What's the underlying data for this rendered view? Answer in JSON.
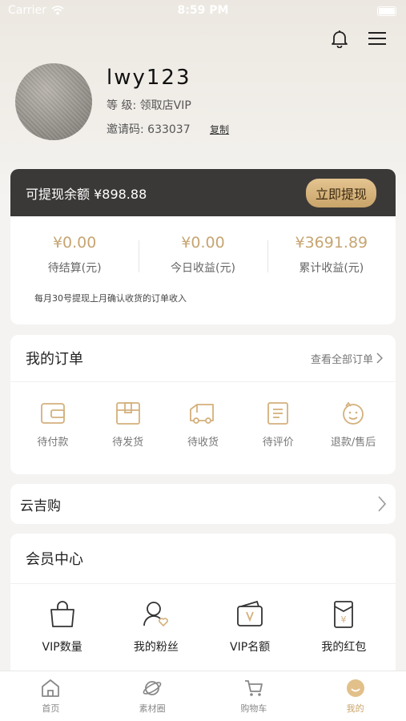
{
  "status_bar": {
    "carrier": "Carrier",
    "time": "8:59 PM"
  },
  "profile": {
    "username": "lwy123",
    "level": "等 级: 领取店VIP",
    "invite_code": "邀请码: 633037",
    "copy_label": "复制"
  },
  "wallet": {
    "withdrawable": "可提现余额 ¥898.88",
    "withdraw_button": "立即提现",
    "stats": [
      {
        "value": "¥0.00",
        "label": "待结算(元)"
      },
      {
        "value": "¥0.00",
        "label": "今日收益(元)"
      },
      {
        "value": "¥3691.89",
        "label": "累计收益(元)"
      }
    ],
    "note": "每月30号提现上月确认收货的订单收入"
  },
  "orders": {
    "title": "我的订单",
    "view_all": "查看全部订单",
    "items": [
      {
        "label": "待付款",
        "icon": "wallet-icon"
      },
      {
        "label": "待发货",
        "icon": "box-icon"
      },
      {
        "label": "待收货",
        "icon": "truck-icon"
      },
      {
        "label": "待评价",
        "icon": "review-icon"
      },
      {
        "label": "退款/售后",
        "icon": "refund-icon"
      }
    ]
  },
  "yunjigou": {
    "title": "云吉购"
  },
  "member": {
    "title": "会员中心",
    "items": [
      {
        "label": "VIP数量",
        "icon": "bag-icon"
      },
      {
        "label": "我的粉丝",
        "icon": "fans-icon"
      },
      {
        "label": "VIP名额",
        "icon": "vip-card-icon"
      },
      {
        "label": "我的红包",
        "icon": "red-packet-icon"
      }
    ]
  },
  "tabbar": {
    "items": [
      {
        "label": "首页",
        "icon": "home-icon"
      },
      {
        "label": "素材圈",
        "icon": "planet-icon"
      },
      {
        "label": "购物车",
        "icon": "cart-icon"
      },
      {
        "label": "我的",
        "icon": "smile-icon",
        "active": true
      }
    ]
  },
  "colors": {
    "accent": "#c9a46a",
    "dark_bar": "#3b3938",
    "value": "#c7a572"
  }
}
